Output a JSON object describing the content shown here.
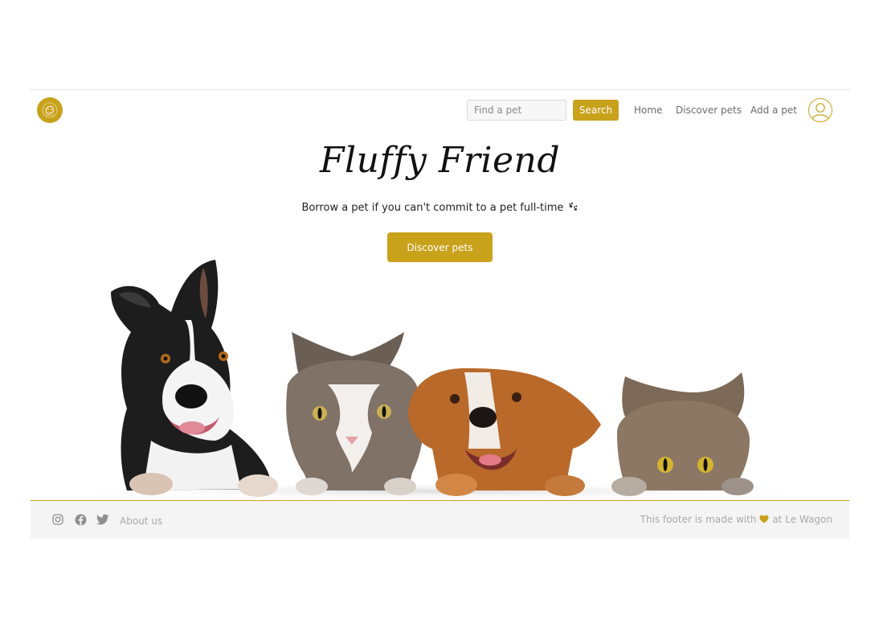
{
  "navbar": {
    "search": {
      "placeholder": "Find a pet",
      "button_label": "Search"
    },
    "links": {
      "home": "Home",
      "discover": "Discover pets",
      "add": "Add a pet"
    },
    "avatar_icon": "user-icon",
    "logo_icon": "pet-logo-icon"
  },
  "hero": {
    "title": "Fluffy Friend",
    "subtitle": "Borrow a pet if you can't commit to a pet full-time",
    "subtitle_icon": "paw-prints-icon",
    "cta_label": "Discover pets"
  },
  "footer": {
    "social_icons": [
      "instagram-icon",
      "facebook-icon",
      "twitter-icon"
    ],
    "about_label": "About us",
    "credit_prefix": "This footer is made with",
    "credit_suffix": "at Le Wagon"
  },
  "colors": {
    "accent": "#c9a21c",
    "text_dark": "#222222",
    "text_muted": "#6c6c6c",
    "footer_bg": "#f4f4f4"
  }
}
